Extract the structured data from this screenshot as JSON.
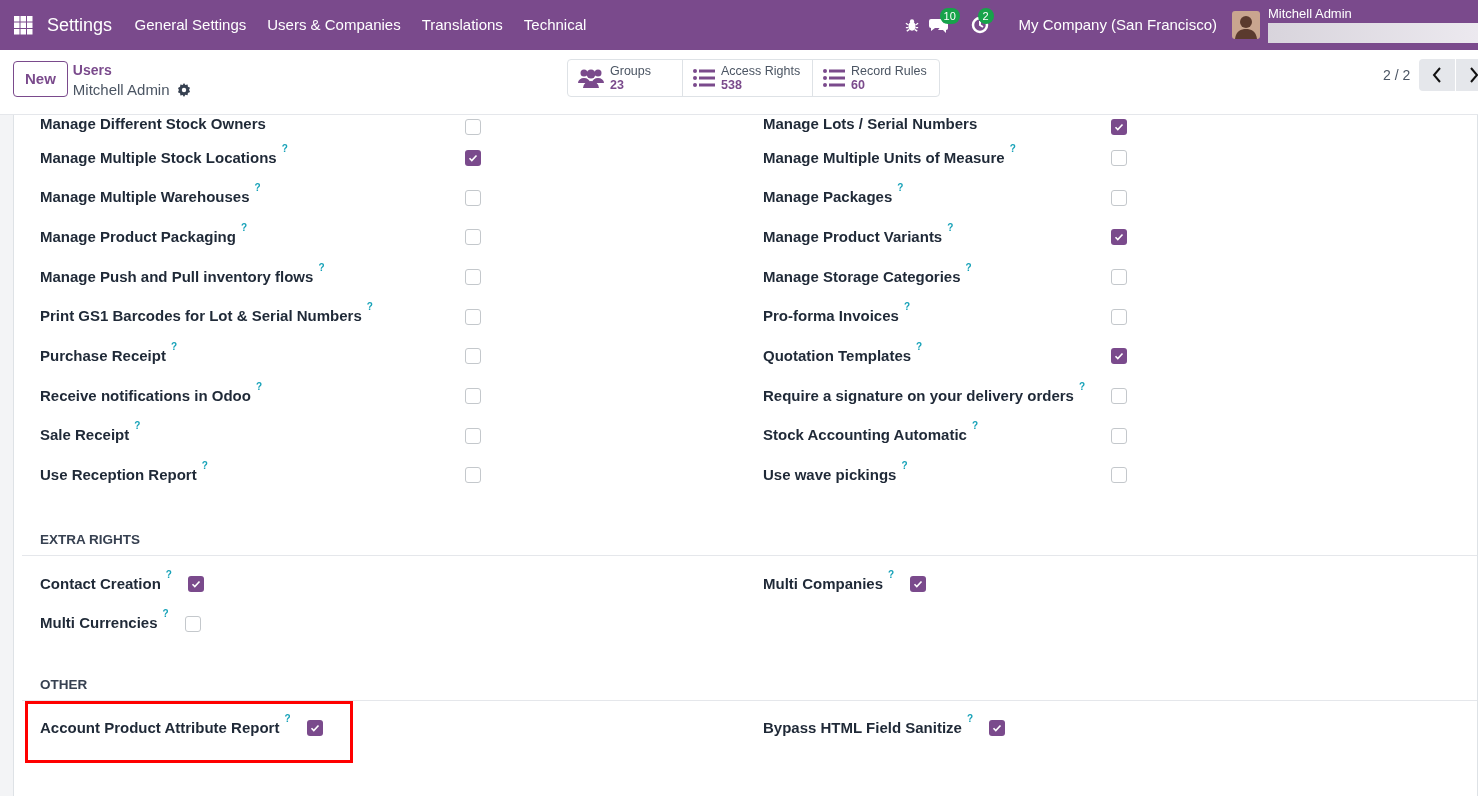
{
  "navbar": {
    "app_title": "Settings",
    "menu": [
      "General Settings",
      "Users & Companies",
      "Translations",
      "Technical"
    ],
    "messages_count": "10",
    "activities_count": "2",
    "company": "My Company (San Francisco)",
    "user_name": "Mitchell Admin"
  },
  "control_panel": {
    "new_button": "New",
    "breadcrumb": "Users",
    "record_name": "Mitchell Admin",
    "smart_buttons": [
      {
        "kind": "groups",
        "label": "Groups",
        "count": "23"
      },
      {
        "kind": "list",
        "label": "Access Rights",
        "count": "538"
      },
      {
        "kind": "list",
        "label": "Record Rules",
        "count": "60"
      }
    ],
    "pager": "2 / 2"
  },
  "technical_rights": [
    {
      "label": "Manage Different Stock Owners",
      "checked": false
    },
    {
      "label": "Manage Lots / Serial Numbers",
      "checked": true
    },
    {
      "label": "Manage Multiple Stock Locations",
      "help": "?",
      "checked": true
    },
    {
      "label": "Manage Multiple Units of Measure",
      "help": "?",
      "checked": false
    },
    {
      "label": "Manage Multiple Warehouses",
      "help": "?",
      "checked": false
    },
    {
      "label": "Manage Packages",
      "help": "?",
      "checked": false
    },
    {
      "label": "Manage Product Packaging",
      "help": "?",
      "checked": false
    },
    {
      "label": "Manage Product Variants",
      "help": "?",
      "checked": true
    },
    {
      "label": "Manage Push and Pull inventory flows",
      "help": "?",
      "checked": false
    },
    {
      "label": "Manage Storage Categories",
      "help": "?",
      "checked": false
    },
    {
      "label": "Print GS1 Barcodes for Lot & Serial Numbers",
      "help": "?",
      "checked": false
    },
    {
      "label": "Pro-forma Invoices",
      "help": "?",
      "checked": false
    },
    {
      "label": "Purchase Receipt",
      "help": "?",
      "checked": false
    },
    {
      "label": "Quotation Templates",
      "help": "?",
      "checked": true
    },
    {
      "label": "Receive notifications in Odoo",
      "help": "?",
      "checked": false
    },
    {
      "label": "Require a signature on your delivery orders",
      "help": "?",
      "checked": false
    },
    {
      "label": "Sale Receipt",
      "help": "?",
      "checked": false
    },
    {
      "label": "Stock Accounting Automatic",
      "help": "?",
      "checked": false
    },
    {
      "label": "Use Reception Report",
      "help": "?",
      "checked": false
    },
    {
      "label": "Use wave pickings",
      "help": "?",
      "checked": false
    }
  ],
  "sections": [
    {
      "title": "EXTRA RIGHTS",
      "items": [
        {
          "label": "Contact Creation",
          "help": "?",
          "checked": true,
          "highlighted": false
        },
        {
          "label": "Multi Companies",
          "help": "?",
          "checked": true,
          "highlighted": false
        },
        {
          "label": "Multi Currencies",
          "help": "?",
          "checked": false,
          "highlighted": false
        }
      ]
    },
    {
      "title": "OTHER",
      "items": [
        {
          "label": "Account Product Attribute Report",
          "help": "?",
          "checked": true,
          "highlighted": true
        },
        {
          "label": "Bypass HTML Field Sanitize",
          "help": "?",
          "checked": true,
          "highlighted": false
        }
      ]
    }
  ]
}
